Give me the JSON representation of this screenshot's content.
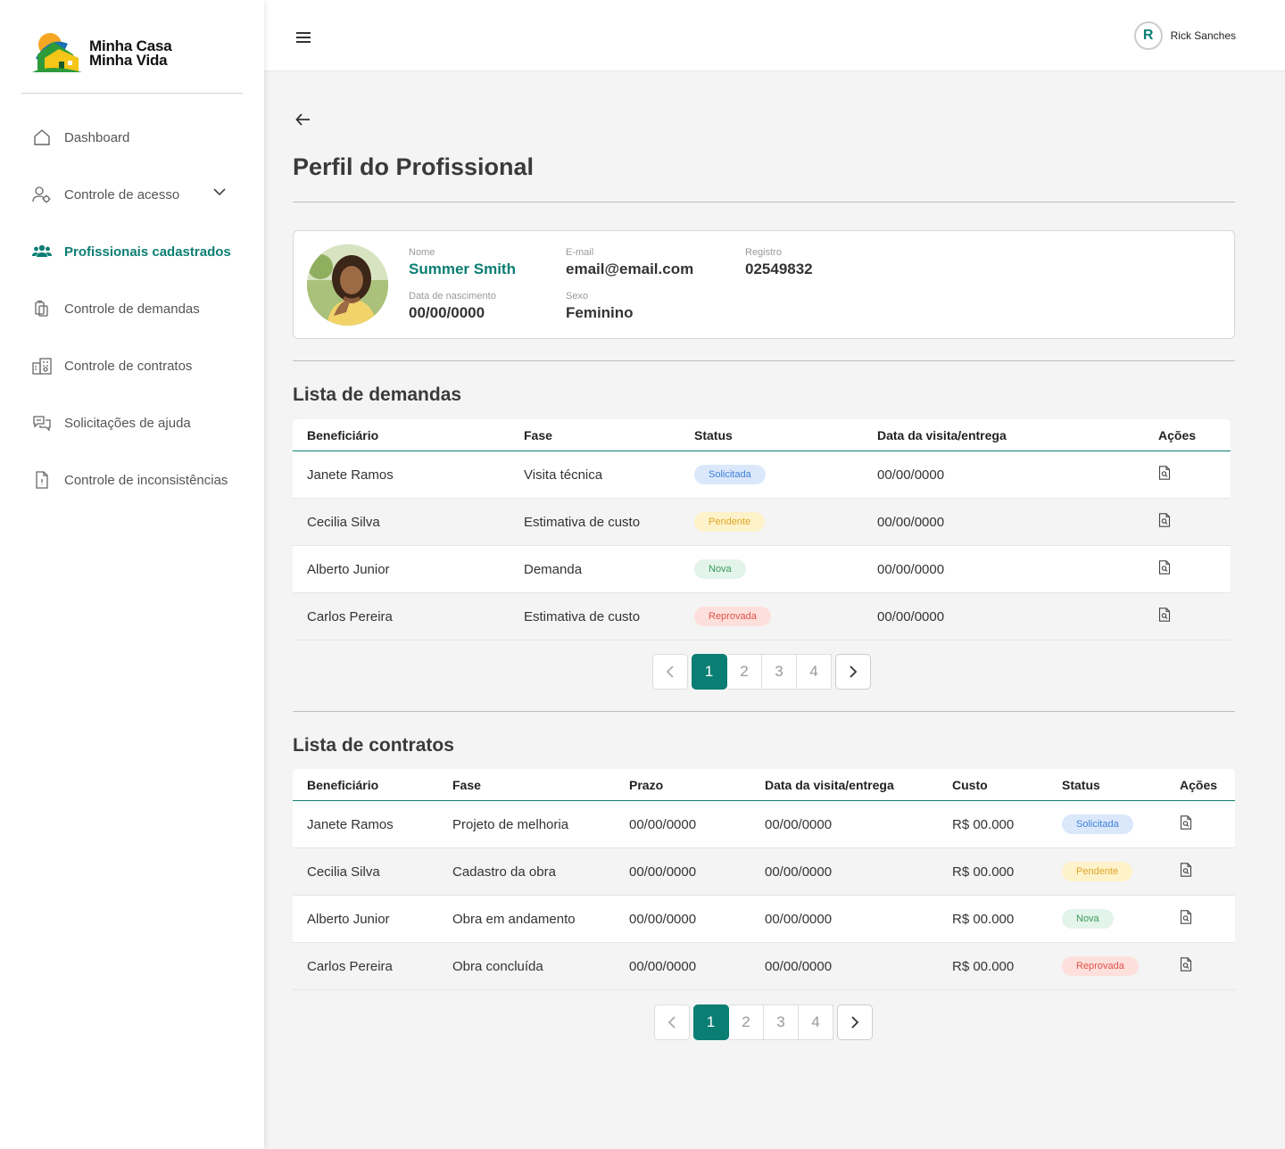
{
  "brand": {
    "line1": "Minha Casa",
    "line2": "Minha Vida"
  },
  "sidebar": {
    "items": [
      {
        "label": "Dashboard",
        "icon": "home-icon"
      },
      {
        "label": "Controle de acesso",
        "icon": "users-settings-icon"
      },
      {
        "label": "Profissionais cadastrados",
        "icon": "people-icon"
      },
      {
        "label": "Controle de demandas",
        "icon": "clipboard-icon"
      },
      {
        "label": "Controle de contratos",
        "icon": "building-icon"
      },
      {
        "label": "Solicitações de ajuda",
        "icon": "chat-icon"
      },
      {
        "label": "Controle de inconsistências",
        "icon": "document-icon"
      }
    ]
  },
  "header": {
    "user_initial": "R",
    "user_name": "Rick Sanches"
  },
  "page": {
    "title": "Perfil do Profissional"
  },
  "profile": {
    "name_label": "Nome",
    "name": "Summer Smith",
    "email_label": "E-mail",
    "email": "email@email.com",
    "registry_label": "Registro",
    "registry": "02549832",
    "birth_label": "Data de nascimento",
    "birth": "00/00/0000",
    "sex_label": "Sexo",
    "sex": "Feminino"
  },
  "demandas": {
    "title": "Lista de demandas",
    "headers": [
      "Beneficiário",
      "Fase",
      "Status",
      "Data da visita/entrega",
      "Ações"
    ],
    "rows": [
      {
        "beneficiario": "Janete Ramos",
        "fase": "Visita técnica",
        "status": "Solicitada",
        "data": "00/00/0000"
      },
      {
        "beneficiario": "Cecilia Silva",
        "fase": "Estimativa de custo",
        "status": "Pendente",
        "data": "00/00/0000"
      },
      {
        "beneficiario": "Alberto Junior",
        "fase": "Demanda",
        "status": "Nova",
        "data": "00/00/0000"
      },
      {
        "beneficiario": "Carlos Pereira",
        "fase": "Estimativa de custo",
        "status": "Reprovada",
        "data": "00/00/0000"
      }
    ],
    "pages": [
      "1",
      "2",
      "3",
      "4"
    ],
    "current_page": "1"
  },
  "contratos": {
    "title": "Lista de contratos",
    "headers": [
      "Beneficiário",
      "Fase",
      "Prazo",
      "Data da visita/entrega",
      "Custo",
      "Status",
      "Ações"
    ],
    "rows": [
      {
        "beneficiario": "Janete Ramos",
        "fase": "Projeto de melhoria",
        "prazo": "00/00/0000",
        "data": "00/00/0000",
        "custo": "R$ 00.000",
        "status": "Solicitada"
      },
      {
        "beneficiario": "Cecilia Silva",
        "fase": "Cadastro da obra",
        "prazo": "00/00/0000",
        "data": "00/00/0000",
        "custo": "R$ 00.000",
        "status": "Pendente"
      },
      {
        "beneficiario": "Alberto Junior",
        "fase": "Obra em andamento",
        "prazo": "00/00/0000",
        "data": "00/00/0000",
        "custo": "R$ 00.000",
        "status": "Nova"
      },
      {
        "beneficiario": "Carlos Pereira",
        "fase": "Obra concluída",
        "prazo": "00/00/0000",
        "data": "00/00/0000",
        "custo": "R$ 00.000",
        "status": "Reprovada"
      }
    ],
    "pages": [
      "1",
      "2",
      "3",
      "4"
    ],
    "current_page": "1"
  },
  "status_colors": {
    "Solicitada": {
      "bg": "#dbe8fb",
      "fg": "#3f7fd8"
    },
    "Pendente": {
      "bg": "#fdf2c9",
      "fg": "#e0a52a"
    },
    "Nova": {
      "bg": "#e3f4ea",
      "fg": "#3a9a5b"
    },
    "Reprovada": {
      "bg": "#fde0dc",
      "fg": "#e0524a"
    }
  },
  "accent_color": "#0b7e73"
}
